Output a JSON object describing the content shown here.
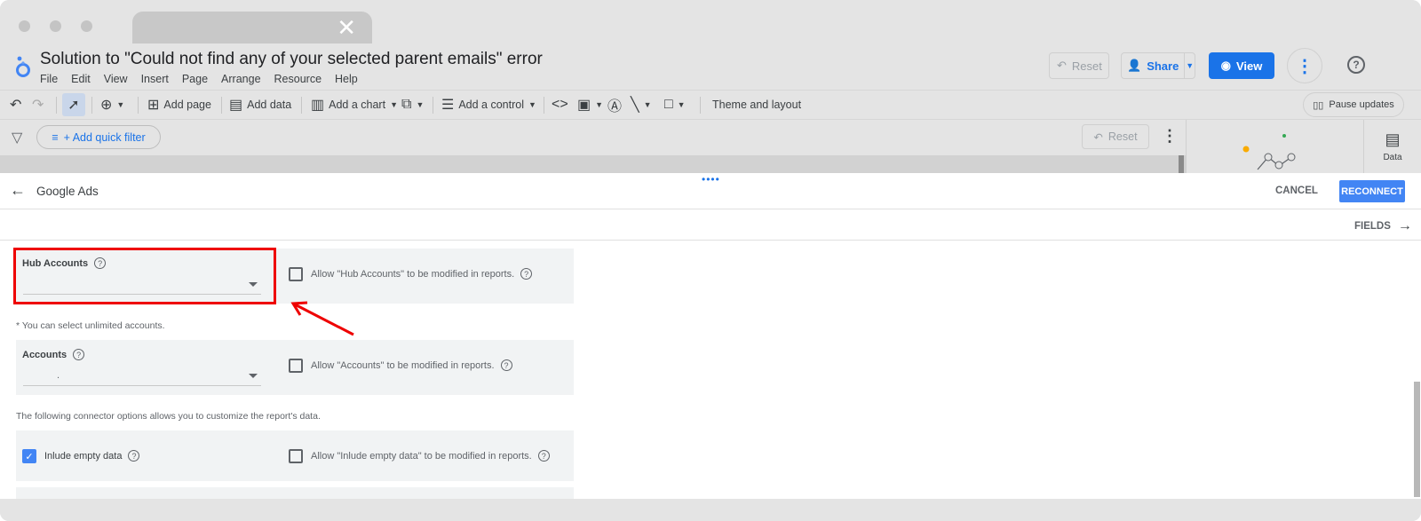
{
  "browser": {
    "tab_close": "✕"
  },
  "app": {
    "title": "Solution to \"Could not find any of your selected parent emails\" error",
    "menu": [
      "File",
      "Edit",
      "View",
      "Insert",
      "Page",
      "Arrange",
      "Resource",
      "Help"
    ],
    "reset_label": "Reset",
    "share_label": "Share",
    "view_label": "View",
    "accent": "#1a73e8"
  },
  "toolbar": {
    "add_page": "Add page",
    "add_data": "Add data",
    "add_chart": "Add a chart",
    "add_control": "Add a control",
    "theme_layout": "Theme and layout",
    "pause_updates": "Pause updates"
  },
  "filterbar": {
    "quick_filter": "+ Add quick filter",
    "reset_label": "Reset"
  },
  "side_tabs": {
    "data_label": "Data"
  },
  "connector": {
    "name": "Google Ads",
    "cancel": "CANCEL",
    "reconnect": "RECONNECT",
    "fields": "FIELDS",
    "hub_accounts": {
      "label": "Hub Accounts",
      "value": "",
      "allow": "Allow \"Hub Accounts\" to be modified in reports.",
      "allow_checked": false
    },
    "unlimited_note": "* You can select unlimited accounts.",
    "accounts": {
      "label": "Accounts",
      "value": ".",
      "allow": "Allow \"Accounts\" to be modified in reports.",
      "allow_checked": false
    },
    "options_note": "The following connector options allows you to customize the report's data.",
    "include_empty": {
      "label": "Inlude empty data",
      "checked": true,
      "allow": "Allow \"Inlude empty data\" to be modified in reports.",
      "allow_checked": false
    }
  },
  "annotation": {
    "highlight_color": "#e00000"
  }
}
